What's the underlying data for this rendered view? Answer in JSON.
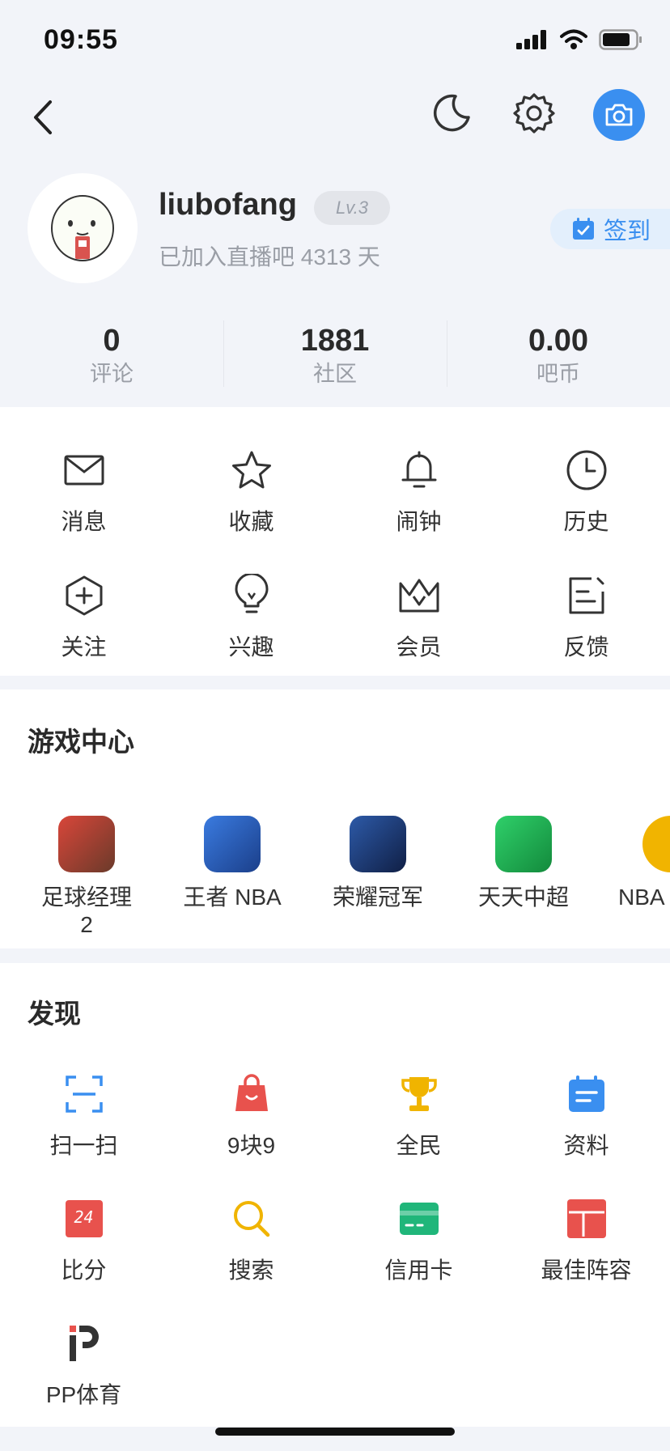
{
  "status_bar": {
    "time": "09:55"
  },
  "profile": {
    "username": "liubofang",
    "level": "Lv.3",
    "joined_text": "已加入直播吧 4313 天",
    "checkin_label": "签到"
  },
  "stats": [
    {
      "value": "0",
      "label": "评论"
    },
    {
      "value": "1881",
      "label": "社区"
    },
    {
      "value": "0.00",
      "label": "吧币"
    }
  ],
  "menu": [
    {
      "label": "消息",
      "icon": "mail-icon"
    },
    {
      "label": "收藏",
      "icon": "star-icon"
    },
    {
      "label": "闹钟",
      "icon": "bell-icon"
    },
    {
      "label": "历史",
      "icon": "clock-icon"
    },
    {
      "label": "关注",
      "icon": "hexagon-plus-icon"
    },
    {
      "label": "兴趣",
      "icon": "lightbulb-icon"
    },
    {
      "label": "会员",
      "icon": "crown-icon"
    },
    {
      "label": "反馈",
      "icon": "feedback-icon"
    }
  ],
  "game_center": {
    "title": "游戏中心",
    "games": [
      {
        "label": "足球经理\n2",
        "color": "#b34a3a"
      },
      {
        "label": "王者 NBA",
        "color": "#2b5fb8"
      },
      {
        "label": "荣耀冠军",
        "color": "#1f3f7a"
      },
      {
        "label": "天天中超",
        "color": "#1fae4f"
      },
      {
        "label": "NBA",
        "color": "#f1b400"
      }
    ]
  },
  "discover": {
    "title": "发现",
    "items": [
      {
        "label": "扫一扫",
        "icon": "scan-icon",
        "color": "#3a8ff0"
      },
      {
        "label": "9块9",
        "icon": "shopping-bag-icon",
        "color": "#e8524d"
      },
      {
        "label": "全民",
        "icon": "trophy-icon",
        "color": "#f0b400"
      },
      {
        "label": "资料",
        "icon": "calendar-icon",
        "color": "#3a8ff0"
      },
      {
        "label": "比分",
        "icon": "score-icon",
        "color": "#e8524d",
        "badge": "24"
      },
      {
        "label": "搜索",
        "icon": "search-icon",
        "color": "#f0b400"
      },
      {
        "label": "信用卡",
        "icon": "credit-card-icon",
        "color": "#20b67a"
      },
      {
        "label": "最佳阵容",
        "icon": "lineup-icon",
        "color": "#e8524d"
      },
      {
        "label": "PP体育",
        "icon": "pp-sports-icon",
        "color": "#e8524d"
      }
    ]
  },
  "colors": {
    "accent": "#3a8ff0",
    "background": "#f2f4f9"
  }
}
